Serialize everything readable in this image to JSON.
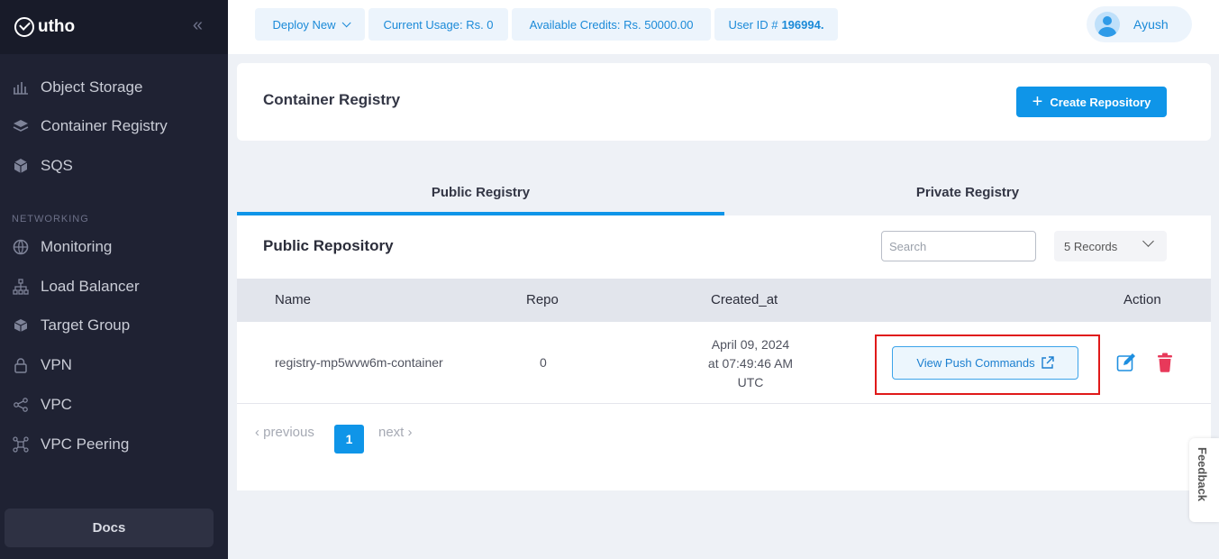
{
  "sidebar": {
    "brand": "utho",
    "section_networking": "NETWORKING",
    "items": [
      {
        "label": "Object Storage",
        "icon": "object-storage-icon"
      },
      {
        "label": "Container Registry",
        "icon": "layers-icon"
      },
      {
        "label": "SQS",
        "icon": "cube-icon"
      },
      {
        "label": "Monitoring",
        "icon": "globe-icon"
      },
      {
        "label": "Load Balancer",
        "icon": "network-icon"
      },
      {
        "label": "Target Group",
        "icon": "box-icon"
      },
      {
        "label": "VPN",
        "icon": "lock-icon"
      },
      {
        "label": "VPC",
        "icon": "share-icon"
      },
      {
        "label": "VPC Peering",
        "icon": "peering-icon"
      }
    ],
    "docs_label": "Docs"
  },
  "topbar": {
    "deploy_label": "Deploy New",
    "usage_label": "Current Usage: Rs. 0",
    "credits_label": "Available Credits: Rs. 50000.00",
    "userid_prefix": "User ID #",
    "userid_value": "196994.",
    "user_name": "Ayush"
  },
  "header": {
    "title": "Container Registry",
    "create_label": "Create Repository"
  },
  "tabs": [
    {
      "label": "Public Registry",
      "active": true
    },
    {
      "label": "Private Registry",
      "active": false
    }
  ],
  "panel": {
    "title": "Public Repository",
    "search_placeholder": "Search",
    "records_label": "5 Records"
  },
  "table": {
    "headers": [
      "Name",
      "Repo",
      "Created_at",
      "Action"
    ],
    "rows": [
      {
        "name": "registry-mp5wvw6m-container",
        "repo": "0",
        "created_line1": "April 09, 2024",
        "created_line2": "at 07:49:46 AM",
        "created_line3": "UTC",
        "push_label": "View Push Commands"
      }
    ]
  },
  "pagination": {
    "previous": "‹ previous",
    "current": "1",
    "next": "next ›"
  },
  "feedback_label": "Feedback",
  "colors": {
    "accent": "#0f95e8",
    "sidebar_bg": "#1f2233",
    "highlight_border": "#e01919",
    "delete": "#e8395a"
  }
}
